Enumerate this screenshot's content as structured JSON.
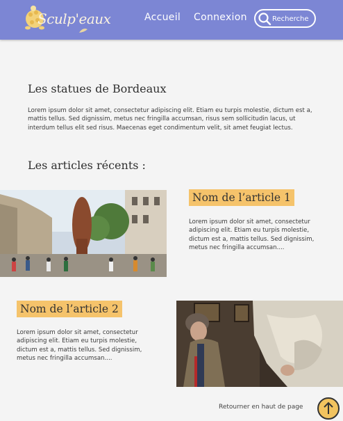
{
  "header": {
    "logo_text": "Sculp'eaux",
    "nav": [
      {
        "label": "Accueil"
      },
      {
        "label": "Connexion"
      }
    ],
    "search": {
      "placeholder": "Recherche"
    }
  },
  "intro": {
    "title": "Les statues de Bordeaux",
    "text": "Lorem ipsum dolor sit amet, consectetur adipiscing elit. Etiam eu turpis molestie, dictum est a, mattis tellus. Sed dignissim, metus nec fringilla accumsan, risus sem sollicitudin lacus, ut interdum tellus elit sed risus. Maecenas eget condimentum velit, sit amet feugiat lectus."
  },
  "recent": {
    "heading": "Les articles récents :",
    "articles": [
      {
        "title": "Nom de l’article 1",
        "excerpt": "Lorem ipsum dolor sit amet, consectetur adipiscing elit. Etiam eu turpis molestie, dictum est a, mattis tellus. Sed dignissim, metus nec fringilla accumsan...."
      },
      {
        "title": "Nom de l’article 2",
        "excerpt": "Lorem ipsum dolor sit amet, consectetur adipiscing elit. Etiam eu turpis molestie, dictum est a, mattis tellus. Sed dignissim, metus nec fringilla accumsan...."
      }
    ]
  },
  "footer": {
    "back_to_top": "Retourner en haut de page"
  },
  "colors": {
    "header": "#7c86d4",
    "accent": "#f5c36b",
    "background": "#f4f4f4"
  }
}
